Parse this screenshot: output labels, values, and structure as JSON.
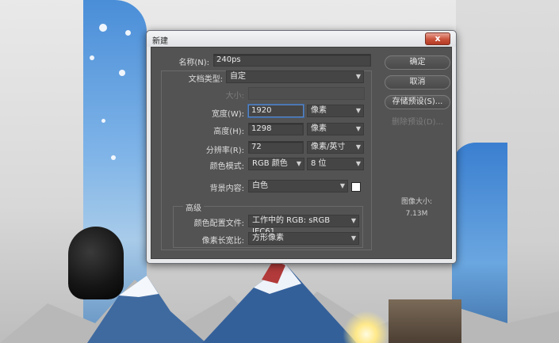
{
  "dialog": {
    "title": "新建",
    "close_label": "x",
    "name_label": "名称(N):",
    "name_value": "240ps",
    "doc_type_label": "文档类型:",
    "doc_type_value": "自定",
    "size_label": "大小:",
    "width_label": "宽度(W):",
    "width_value": "1920",
    "width_unit": "像素",
    "height_label": "高度(H):",
    "height_value": "1298",
    "height_unit": "像素",
    "resolution_label": "分辨率(R):",
    "resolution_value": "72",
    "resolution_unit": "像素/英寸",
    "color_mode_label": "颜色模式:",
    "color_mode_value": "RGB 颜色",
    "bit_depth_value": "8 位",
    "background_label": "背景内容:",
    "background_value": "白色",
    "advanced_label": "高级",
    "color_profile_label": "颜色配置文件:",
    "color_profile_value": "工作中的 RGB: sRGB IEC61...",
    "pixel_aspect_label": "像素长宽比:",
    "pixel_aspect_value": "方形像素",
    "buttons": {
      "ok": "确定",
      "cancel": "取消",
      "save_preset": "存储预设(S)...",
      "delete_preset": "删除预设(D)..."
    },
    "image_size_label": "图像大小:",
    "image_size_value": "7.13M"
  },
  "colors": {
    "dialog_bg": "#535353",
    "field_bg": "#454545",
    "focus_border": "#5b86c2",
    "close_red": "#c9523b"
  }
}
